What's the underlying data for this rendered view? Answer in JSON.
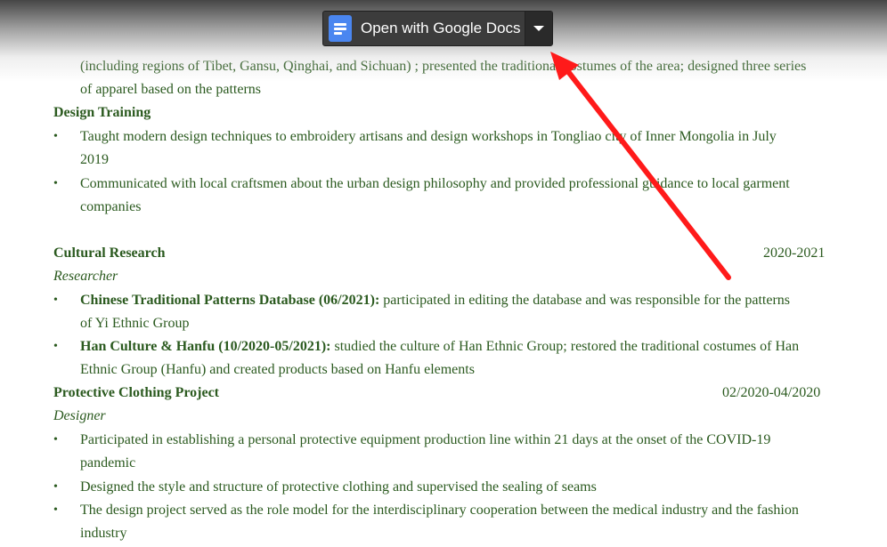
{
  "toolbar": {
    "open_with_label": "Open with Google Docs",
    "icon": "google-docs-icon",
    "dropdown_icon": "caret-down-icon"
  },
  "colors": {
    "text": "#2b5a1f",
    "arrow": "#ff1a1a",
    "button_bg": "#3c3c3c"
  },
  "resume": {
    "art": {
      "line1": "(including regions of Tibet, Gansu, Qinghai, and Sichuan) ; presented the traditional costumes of the area; designed three series",
      "line2": "of apparel based on the patterns"
    },
    "design_training": {
      "heading": "Design Training",
      "b1_line1": "Taught modern design techniques to embroidery artisans and design workshops in Tongliao city of Inner Mongolia in July",
      "b1_line2": "2019",
      "b2_line1": "Communicated with local craftsmen about the urban design philosophy and provided professional guidance to local garment",
      "b2_line2": "companies"
    },
    "cultural_research": {
      "heading": "Cultural Research",
      "date": "2020-2021",
      "role": "Researcher",
      "b1_bold": "Chinese Traditional Patterns Database (06/2021):",
      "b1_rest": " participated in editing the database and was responsible for the patterns",
      "b1_line2": "of Yi Ethnic Group",
      "b2_bold": "Han Culture & Hanfu (10/2020-05/2021):",
      "b2_rest": " studied the culture of Han Ethnic Group; restored the traditional costumes of Han",
      "b2_line2": "Ethnic Group (Hanfu) and created products based on Hanfu elements"
    },
    "protective": {
      "heading": "Protective Clothing Project",
      "date": "02/2020-04/2020",
      "role": "Designer",
      "b1_line1": "Participated in establishing a personal protective equipment production line within 21 days at the onset of the COVID-19",
      "b1_line2": "pandemic",
      "b2_line1": "Designed the style and structure of protective clothing and supervised the sealing of seams",
      "b3_line1": "The design project served as the role model for the interdisciplinary cooperation between the medical industry and the fashion",
      "b3_line2": "industry"
    },
    "bullet_char": "•"
  }
}
